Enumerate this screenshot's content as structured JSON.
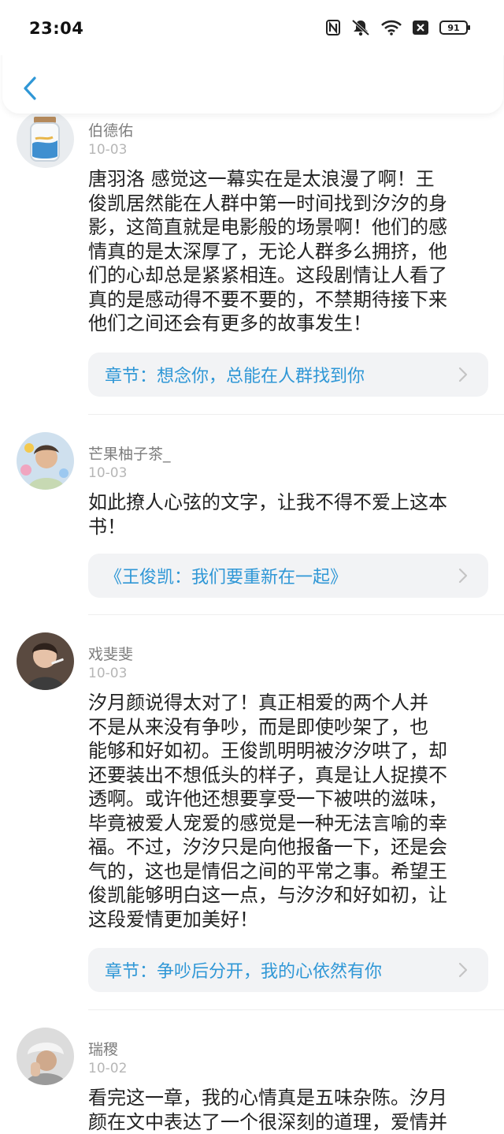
{
  "status": {
    "time": "23:04",
    "battery": "91",
    "icons": [
      "nfc-icon",
      "mute-icon",
      "wifi-icon",
      "close-box-icon",
      "battery-icon"
    ]
  },
  "header": {
    "back_icon": "chevron-left-icon"
  },
  "accent_color": "#2f97d6",
  "comments": [
    {
      "user": "伯德佑",
      "date": "10-03",
      "text": "唐羽洛 感觉这一幕实在是太浪漫了啊！王\n俊凯居然能在人群中第一时间找到汐汐的身\n影，这简直就是电影般的场景啊！他们的感\n情真的是太深厚了，无论人群多么拥挤，他\n们的心却总是紧紧相连。这段剧情让人看了\n真的是感动得不要不要的，不禁期待接下来\n他们之间还会有更多的故事发生！",
      "chapter": "章节：想念你，总能在人群找到你"
    },
    {
      "user": "芒果柚子茶_",
      "date": "10-03",
      "text": "如此撩人心弦的文字，让我不得不爱上这本\n书！",
      "chapter": "《王俊凯：我们要重新在一起》"
    },
    {
      "user": "戏斐斐",
      "date": "10-03",
      "text": "汐月颜说得太对了！真正相爱的两个人并\n不是从来没有争吵，而是即使吵架了，也\n能够和好如初。王俊凯明明被汐汐哄了，却\n还要装出不想低头的样子，真是让人捉摸不\n透啊。或许他还想要享受一下被哄的滋味，\n毕竟被爱人宠爱的感觉是一种无法言喻的幸\n福。不过，汐汐只是向他报备一下，还是会\n气的，这也是情侣之间的平常之事。希望王\n俊凯能够明白这一点，与汐汐和好如初，让\n这段爱情更加美好！",
      "chapter": "章节：争吵后分开，我的心依然有你"
    },
    {
      "user": "瑞稷",
      "date": "10-02",
      "text": "看完这一章，我的心情真是五味杂陈。汐月\n颜在文中表达了一个很深刻的道理，爱情并"
    }
  ]
}
